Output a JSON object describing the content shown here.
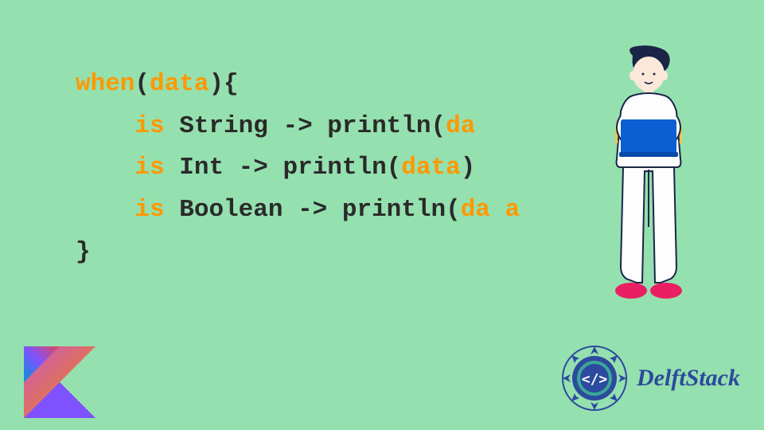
{
  "code": {
    "line1_when": "when",
    "line1_paren1": "(",
    "line1_data": "data",
    "line1_paren2": "){",
    "line2_indent": "    ",
    "line2_is": "is",
    "line2_rest": " String -> println(",
    "line2_data": "da",
    "line3_indent": "    ",
    "line3_is": "is",
    "line3_rest": " Int -> println(",
    "line3_data": "data",
    "line3_close": ")",
    "line4_indent": "    ",
    "line4_is": "is",
    "line4_rest": " Boolean -> println(",
    "line4_data": "da a",
    "line5_close": "}"
  },
  "brand": {
    "name": "DelftStack"
  },
  "colors": {
    "background": "#95e0af",
    "keyword": "#ff9800",
    "text": "#2a2a2a",
    "brand": "#2c4a9e",
    "kotlin_purple": "#7f52ff",
    "kotlin_orange": "#f88909",
    "laptop": "#0b5fd3",
    "shoes": "#e91e63"
  }
}
